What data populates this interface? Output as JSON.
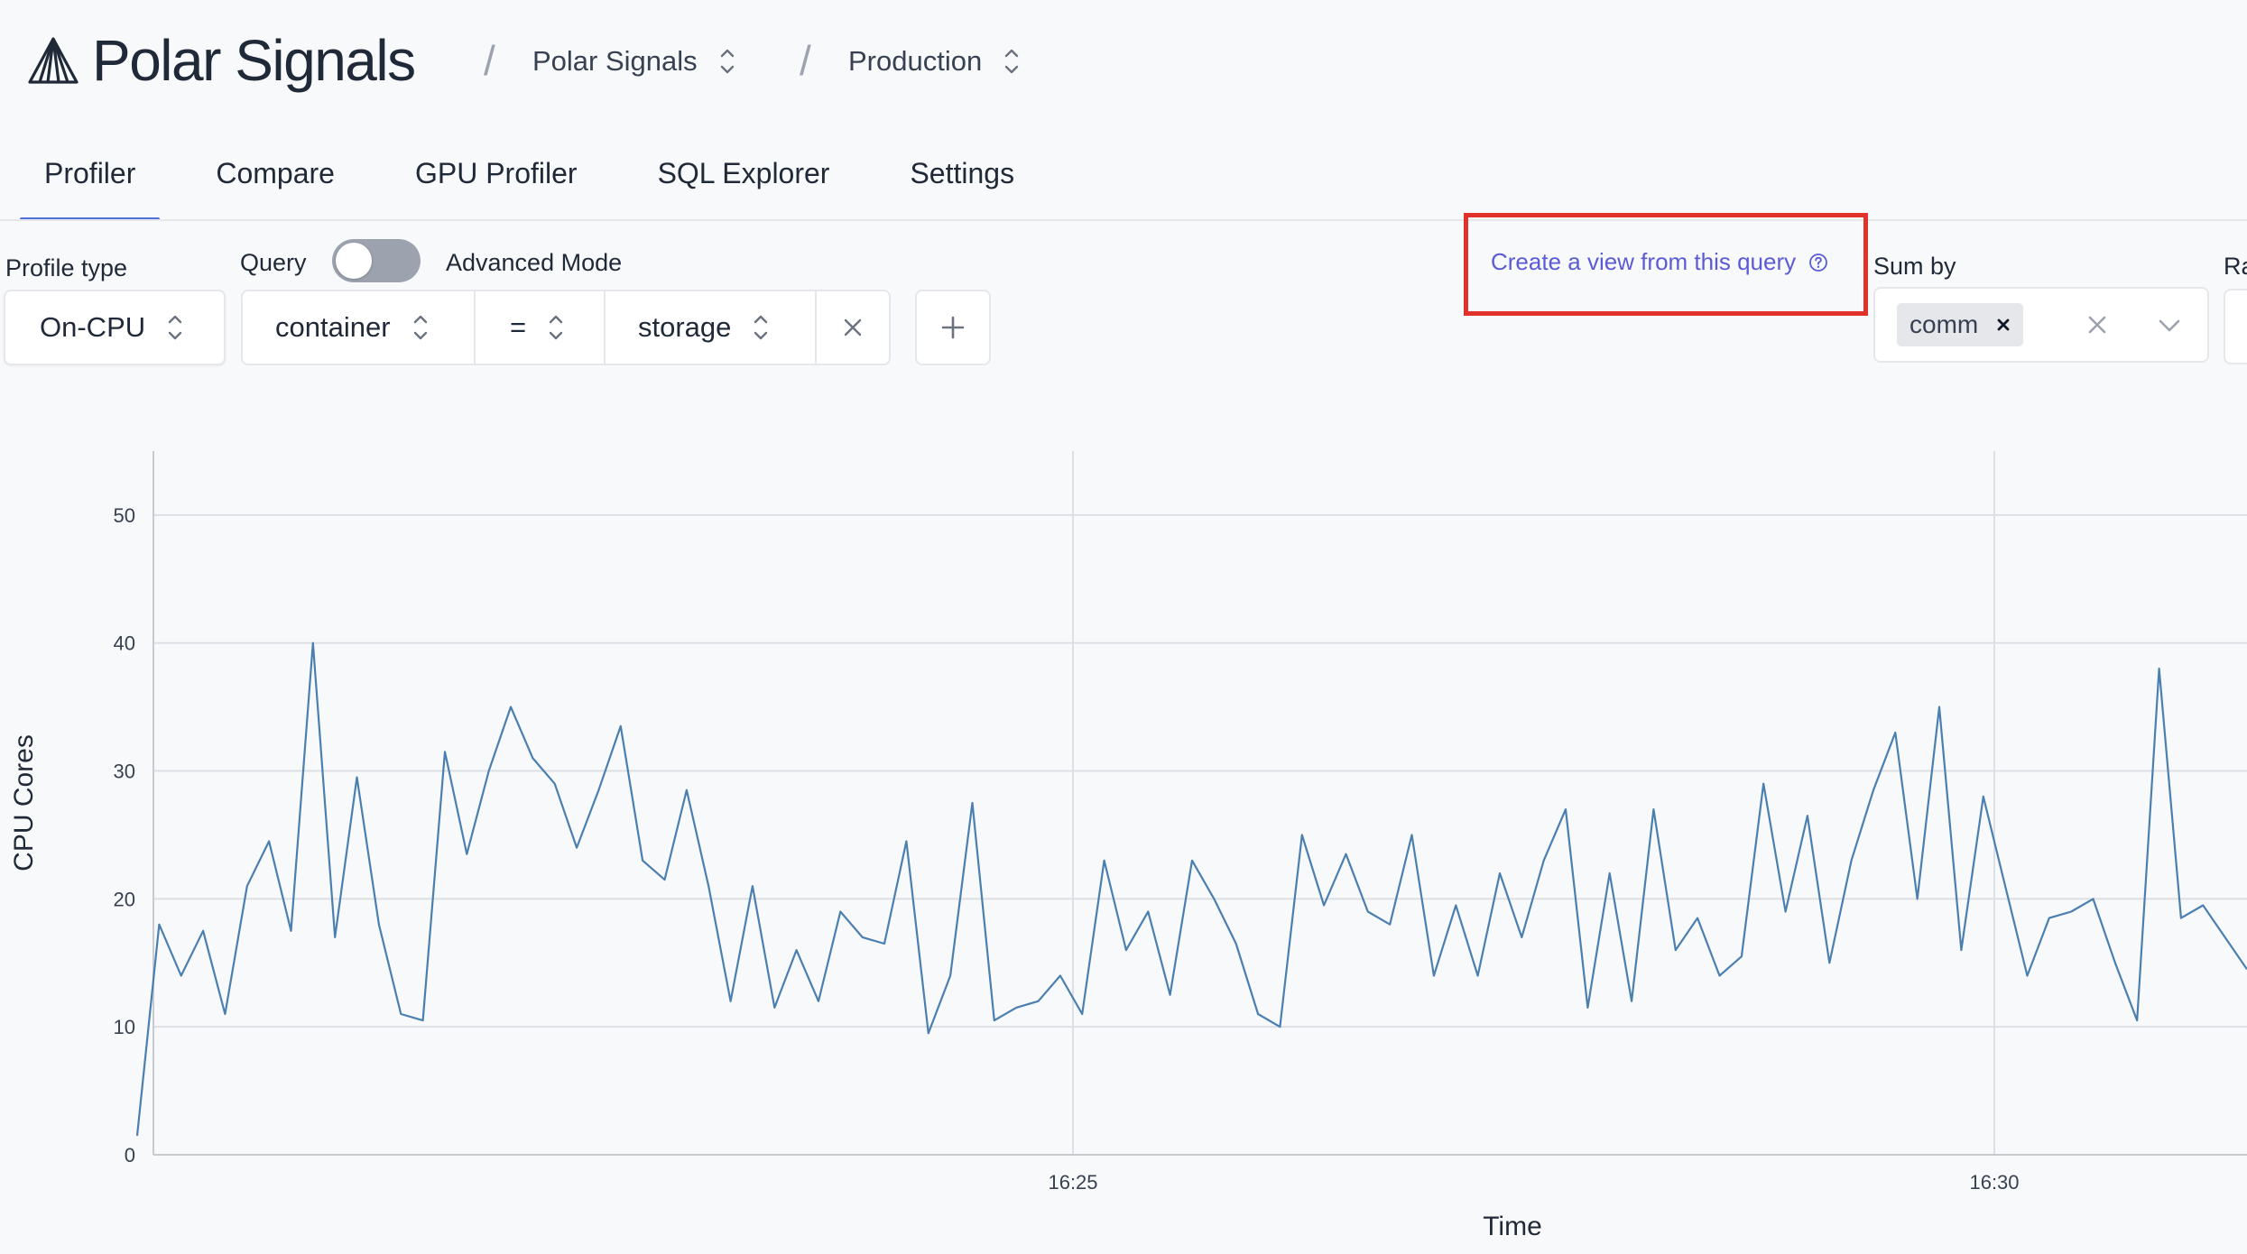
{
  "header": {
    "brand": "Polar Signals",
    "breadcrumbs": [
      {
        "label": "Polar Signals"
      },
      {
        "label": "Production"
      }
    ]
  },
  "tabs": [
    {
      "label": "Profiler",
      "active": true
    },
    {
      "label": "Compare",
      "active": false
    },
    {
      "label": "GPU Profiler",
      "active": false
    },
    {
      "label": "SQL Explorer",
      "active": false
    },
    {
      "label": "Settings",
      "active": false
    }
  ],
  "query_bar": {
    "profile_type_label": "Profile type",
    "profile_type_value": "On-CPU",
    "query_label": "Query",
    "advanced_mode_label": "Advanced Mode",
    "advanced_mode_on": false,
    "filter": {
      "key": "container",
      "operator": "=",
      "value": "storage"
    },
    "create_view_label": "Create a view from this query",
    "sum_by_label": "Sum by",
    "sum_by_tags": [
      "comm"
    ],
    "cut_label": "Ra"
  },
  "colors": {
    "accent": "#4f6ddc",
    "link": "#5b5bd6",
    "series": "#4a7fb0",
    "highlight": "#e0312a"
  },
  "chart_data": {
    "type": "line",
    "xlabel": "Time",
    "ylabel": "CPU Cores",
    "ylim": [
      0,
      55
    ],
    "y_ticks": [
      0,
      10,
      20,
      30,
      40,
      50
    ],
    "x_ticks": [
      "16:25",
      "16:30"
    ],
    "series": [
      {
        "values": [
          1.5,
          18,
          14,
          17.5,
          11,
          21,
          24.5,
          17.5,
          40,
          17,
          29.5,
          18,
          11,
          10.5,
          31.5,
          23.5,
          30,
          35,
          31,
          29,
          24,
          28.5,
          33.5,
          23,
          21.5,
          28.5,
          21,
          12,
          21,
          11.5,
          16,
          12,
          19,
          17,
          16.5,
          24.5,
          9.5,
          14,
          27.5,
          10.5,
          11.5,
          12,
          14,
          11,
          23,
          16,
          19,
          12.5,
          23,
          20,
          16.5,
          11,
          10,
          25,
          19.5,
          23.5,
          19,
          18,
          25,
          14,
          19.5,
          14,
          22,
          17,
          23,
          27,
          11.5,
          22,
          12,
          27,
          16,
          18.5,
          14,
          15.5,
          29,
          19,
          26.5,
          15,
          23,
          28.5,
          33,
          20,
          35,
          16,
          28,
          21,
          14,
          18.5,
          19,
          20,
          15,
          10.5,
          38,
          18.5,
          19.5,
          17,
          14.5
        ]
      }
    ]
  }
}
